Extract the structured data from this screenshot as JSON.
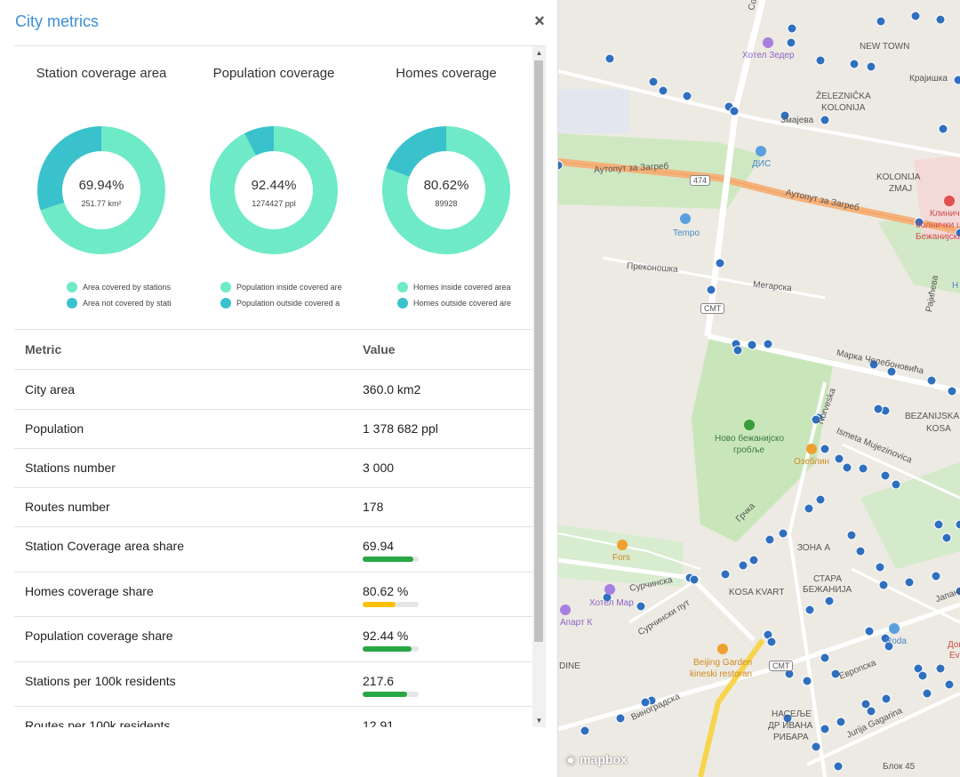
{
  "panel": {
    "title": "City metrics",
    "close_icon": "close-icon",
    "charts": [
      {
        "title": "Station coverage area",
        "center_value": "69.94%",
        "center_sub": "251.77 km²",
        "share": 0.6994,
        "legend": [
          "Area covered by stations",
          "Area not covered by stati"
        ]
      },
      {
        "title": "Population coverage",
        "center_value": "92.44%",
        "center_sub": "1274427 ppl",
        "share": 0.9244,
        "legend": [
          "Population inside covered are",
          "Population outside covered a"
        ]
      },
      {
        "title": "Homes coverage",
        "center_value": "80.62%",
        "center_sub": "89928",
        "share": 0.8062,
        "legend": [
          "Homes inside covered area",
          "Homes outside covered are"
        ]
      }
    ],
    "colors": {
      "covered": "#6eeac7",
      "uncovered": "#39c2cb",
      "bar_green": "#28a745",
      "bar_yellow": "#ffc107"
    },
    "table": {
      "headers": [
        "Metric",
        "Value"
      ],
      "rows": [
        {
          "metric": "City area",
          "value": "360.0 km2"
        },
        {
          "metric": "Population",
          "value": "1 378 682 ppl"
        },
        {
          "metric": "Stations number",
          "value": "3 000"
        },
        {
          "metric": "Routes number",
          "value": "178"
        },
        {
          "metric": "Station Coverage area share",
          "value": "69.94",
          "bar": 0.9,
          "bar_color": "green"
        },
        {
          "metric": "Homes coverage share",
          "value": "80.62 %",
          "bar": 0.58,
          "bar_color": "yellow"
        },
        {
          "metric": "Population coverage share",
          "value": "92.44 %",
          "bar": 0.88,
          "bar_color": "green"
        },
        {
          "metric": "Stations per 100k residents",
          "value": "217.6",
          "bar": 0.8,
          "bar_color": "green"
        },
        {
          "metric": "Routes per 100k residents",
          "value": "12.91"
        }
      ]
    }
  },
  "map": {
    "labels": {
      "solunska": "Солунска",
      "hotel_zeder": "Хотел Зедер",
      "new_town": "NEW TOWN",
      "krajishka": "Крајишка",
      "zeleznicka": "ŽELEZNIČKA",
      "kolonija": "KOLONIJA",
      "smajeva": "Змајева",
      "dis": "ДИС",
      "autoput1": "Аутопут за Загреб",
      "autoput2": "Аутопут за Загреб",
      "route_474": "474",
      "kolonija_zmaj1": "KOLONIJA",
      "kolonija_zmaj2": "ZMAJ",
      "klinicki": "Клиничк",
      "bolnicki": "болнички ц",
      "bezanijska": "Бежанијска",
      "tempo": "Tempo",
      "prekonoshka": "Преконошка",
      "megarska": "Мегарска",
      "smt1": "СМТ",
      "marka": "Марка Челебоновића",
      "rajicheva": "Рајићева",
      "norveska": "Norveska",
      "bezanijska_kosa1": "BEZANIJSKA",
      "bezanijska_kosa2": "KOSA",
      "novo_groblje1": "Ново бежанијско",
      "novo_groblje2": "гробље",
      "ismeta": "Ismeta Mujezinovica",
      "ozeblin": "Озеблин",
      "grchka": "Грчка",
      "zona_a": "ЗОНА А",
      "fors": "Fors",
      "surchinska": "Сурчинска",
      "kosa_kvart": "KOSA KVART",
      "stara1": "СТАРА",
      "stara2": "БЕЖАНИЈА",
      "hotel_mar": "Хотел Мар",
      "apart_k": "Апарт К",
      "surchinski_put": "Сурчински пут",
      "roda": "Roda",
      "dine": "DINE",
      "beijing1": "Beijing Garden",
      "beijing2": "kineski restoran",
      "smt2": "СМТ",
      "evropska": "Европска",
      "japanska": "Јапанс",
      "vinogradska": "Виноградска",
      "naselje1": "НАСЕЉЕ",
      "naselje2": "ДР ИВАНА",
      "naselje3": "РИБАРА",
      "jurija": "Jurija Gagarina",
      "blok45": "Блок 45",
      "dom": "Дом",
      "ev": "Ev",
      "h": "H",
      "logo": "mapbox"
    }
  }
}
